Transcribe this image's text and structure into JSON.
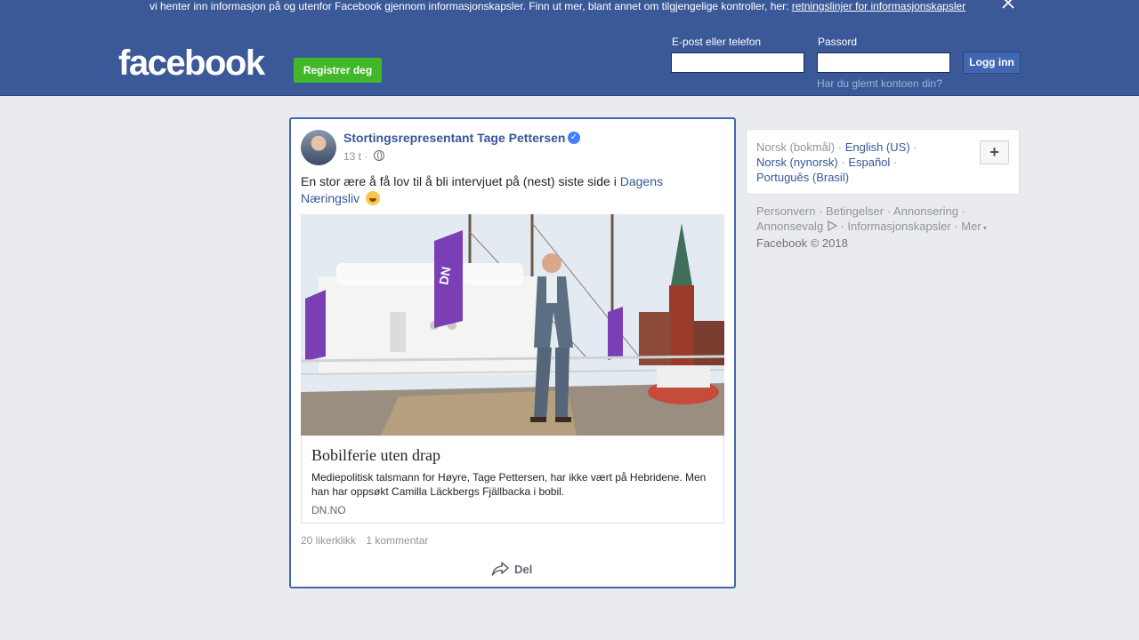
{
  "cookie_banner": {
    "text": "vi henter inn informasjon på og utenfor Facebook gjennom informasjonskapsler. Finn ut mer, blant annet om tilgjengelige kontroller, her:",
    "link": "retningslinjer for informasjonskapsler"
  },
  "header": {
    "logo": "facebook",
    "register_label": "Registrer deg",
    "email_label": "E-post eller telefon",
    "password_label": "Passord",
    "login_label": "Logg inn",
    "forgot_label": "Har du glemt kontoen din?"
  },
  "post": {
    "author": "Stortingsrepresentant Tage Pettersen",
    "time": "13 t",
    "text": "En stor ære å få lov til å bli intervjuet på (nest) siste side i",
    "text_link": "Dagens Næringsliv",
    "link_title": "Bobilferie uten drap",
    "link_desc": "Mediepolitisk talsmann for Høyre, Tage Pettersen, har ikke vært på Hebridene. Men han har oppsøkt Camilla Läckbergs Fjällbacka i bobil.",
    "link_domain": "DN.NO",
    "likes": "20 likerklikk",
    "comments": "1 kommentar",
    "share_label": "Del"
  },
  "languages": {
    "current": "Norsk (bokmål)",
    "items": [
      "English (US)",
      "Norsk (nynorsk)",
      "Español",
      "Português (Brasil)"
    ],
    "add_label": "+"
  },
  "footer": {
    "links": [
      "Personvern",
      "Betingelser",
      "Annonsering",
      "Annonsevalg",
      "Informasjonskapsler",
      "Mer"
    ],
    "copyright": "Facebook © 2018"
  },
  "colors": {
    "brand": "#3b5998",
    "register_green": "#42b72a",
    "link": "#365899"
  }
}
